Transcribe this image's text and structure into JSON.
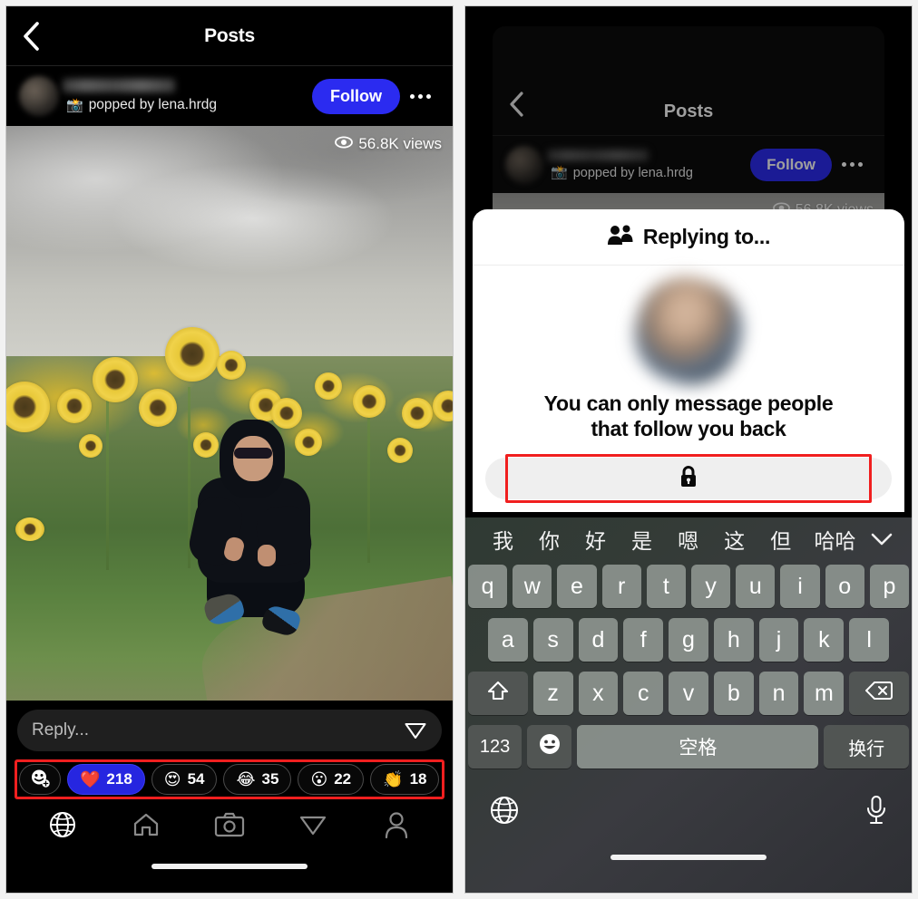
{
  "left": {
    "header": {
      "back_icon": "chevron-left-icon",
      "title": "Posts"
    },
    "author": {
      "name_redacted": "",
      "popped_by": "popped by lena.hrdg",
      "camera_emoji": "📸",
      "follow_label": "Follow",
      "more_icon": "more-options-icon"
    },
    "post": {
      "views": "56.8K views",
      "eye_icon": "eye-icon"
    },
    "reply": {
      "placeholder": "Reply...",
      "value": "",
      "send_icon": "send-icon"
    },
    "reactions": [
      {
        "name": "add-reaction",
        "emoji": "🙂",
        "count": ""
      },
      {
        "name": "heart",
        "emoji": "❤️",
        "count": "218",
        "selected": true
      },
      {
        "name": "heart-eyes",
        "emoji": "😍",
        "count": "54",
        "selected": false
      },
      {
        "name": "joy",
        "emoji": "😂",
        "count": "35",
        "selected": false
      },
      {
        "name": "surprised",
        "emoji": "😮",
        "count": "22",
        "selected": false
      },
      {
        "name": "clap",
        "emoji": "👏",
        "count": "18",
        "selected": false
      }
    ],
    "tabs": [
      {
        "name": "globe",
        "active": true
      },
      {
        "name": "home",
        "active": false
      },
      {
        "name": "camera",
        "active": false
      },
      {
        "name": "messages",
        "active": false
      },
      {
        "name": "profile",
        "active": false
      }
    ]
  },
  "right": {
    "header": {
      "back_icon": "chevron-left-icon",
      "title": "Posts"
    },
    "author": {
      "popped_by": "popped by lena.hrdg",
      "camera_emoji": "📸",
      "follow_label": "Follow",
      "more_icon": "more-options-icon"
    },
    "post": {
      "views": "56.8K views",
      "eye_icon": "eye-icon"
    },
    "sheet": {
      "header_icon": "people-icon",
      "header_title": "Replying to...",
      "avatar": "blurred-avatar",
      "message_line1": "You can only message people",
      "message_line2": "that follow you back",
      "locked_icon": "lock-icon"
    },
    "keyboard": {
      "suggestions": [
        "我",
        "你",
        "好",
        "是",
        "嗯",
        "这",
        "但",
        "哈哈"
      ],
      "expand_icon": "chevron-down-icon",
      "row1": [
        "q",
        "w",
        "e",
        "r",
        "t",
        "y",
        "u",
        "i",
        "o",
        "p"
      ],
      "row2": [
        "a",
        "s",
        "d",
        "f",
        "g",
        "h",
        "j",
        "k",
        "l"
      ],
      "shift_icon": "shift-icon",
      "row3": [
        "z",
        "x",
        "c",
        "v",
        "b",
        "n",
        "m"
      ],
      "backspace_icon": "backspace-icon",
      "numbers_label": "123",
      "emoji_icon": "emoji-icon",
      "space_label": "空格",
      "return_label": "换行",
      "globe_icon": "globe-icon",
      "mic_icon": "microphone-icon"
    }
  },
  "colors": {
    "accent_blue": "#2b2bf0",
    "highlight_red": "#f01f1f",
    "panel_black": "#000000",
    "sheet_white": "#ffffff"
  }
}
